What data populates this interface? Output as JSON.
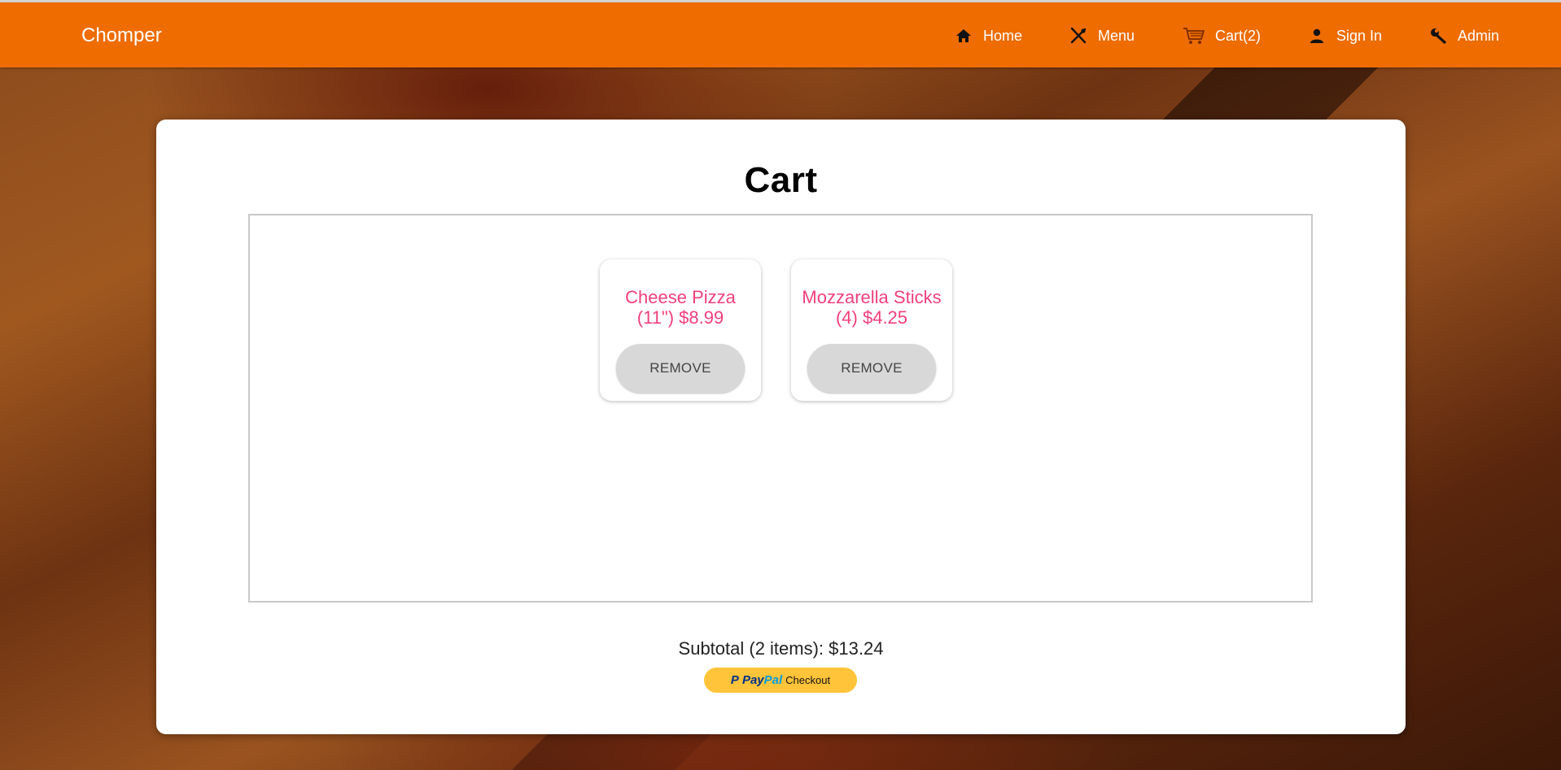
{
  "navbar": {
    "brand": "Chomper",
    "items": [
      {
        "label": "Home",
        "icon": "home-icon"
      },
      {
        "label": "Menu",
        "icon": "utensils-icon"
      },
      {
        "label": "Cart(2)",
        "icon": "cart-icon"
      },
      {
        "label": "Sign In",
        "icon": "user-icon"
      },
      {
        "label": "Admin",
        "icon": "wrench-icon"
      }
    ],
    "colors": {
      "background": "#ee6c00",
      "text": "#ffffff"
    }
  },
  "cart": {
    "title": "Cart",
    "items": [
      {
        "name": "Cheese Pizza (11\") $8.99",
        "remove_label": "REMOVE"
      },
      {
        "name": "Mozzarella Sticks (4) $4.25",
        "remove_label": "REMOVE"
      }
    ],
    "subtotal": "Subtotal (2 items): $13.24",
    "checkout": {
      "brand_pay": "Pay",
      "brand_pal": "Pal",
      "label": "Checkout"
    },
    "colors": {
      "item_text": "#f0407a",
      "checkout_button": "#ffc439"
    }
  }
}
